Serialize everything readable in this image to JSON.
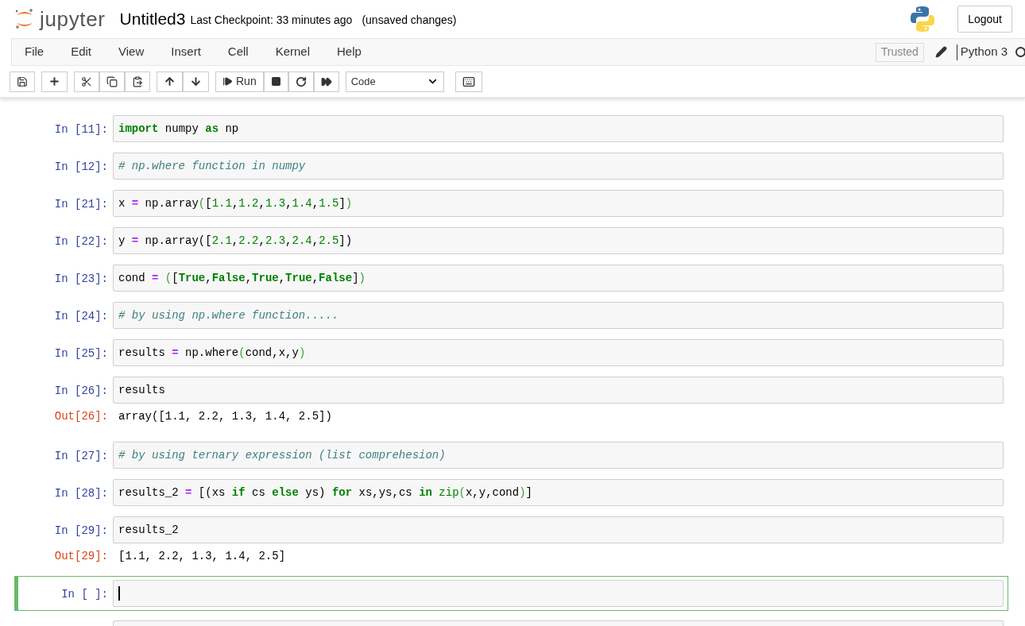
{
  "header": {
    "logo_text": "jupyter",
    "notebook_name": "Untitled3",
    "checkpoint": "Last Checkpoint: 33 minutes ago",
    "save_status": "(unsaved changes)",
    "logout": "Logout"
  },
  "menu": [
    "File",
    "Edit",
    "View",
    "Insert",
    "Cell",
    "Kernel",
    "Help"
  ],
  "status": {
    "trusted": "Trusted",
    "kernel_name": "Python 3",
    "kernel_busy": false
  },
  "toolbar": {
    "run_label": "Run",
    "cell_type": "Code"
  },
  "cells": [
    {
      "prompt": "In [11]:",
      "selected": false,
      "editing": false,
      "code": [
        {
          "kind": "keyword",
          "text": "import"
        },
        {
          "kind": "plain",
          "text": " numpy "
        },
        {
          "kind": "keyword",
          "text": "as"
        },
        {
          "kind": "plain",
          "text": " np"
        }
      ]
    },
    {
      "prompt": "In [12]:",
      "selected": false,
      "editing": false,
      "code": [
        {
          "kind": "comment",
          "text": "# np.where function in numpy"
        }
      ]
    },
    {
      "prompt": "In [21]:",
      "selected": false,
      "editing": false,
      "code": [
        {
          "kind": "plain",
          "text": "x "
        },
        {
          "kind": "operator",
          "text": "="
        },
        {
          "kind": "plain",
          "text": " np.array"
        },
        {
          "kind": "bracket",
          "text": "("
        },
        {
          "kind": "plain",
          "text": "["
        },
        {
          "kind": "number",
          "text": "1.1"
        },
        {
          "kind": "plain",
          "text": ","
        },
        {
          "kind": "number",
          "text": "1.2"
        },
        {
          "kind": "plain",
          "text": ","
        },
        {
          "kind": "number",
          "text": "1.3"
        },
        {
          "kind": "plain",
          "text": ","
        },
        {
          "kind": "number",
          "text": "1.4"
        },
        {
          "kind": "plain",
          "text": ","
        },
        {
          "kind": "number",
          "text": "1.5"
        },
        {
          "kind": "plain",
          "text": "]"
        },
        {
          "kind": "bracket",
          "text": ")"
        }
      ]
    },
    {
      "prompt": "In [22]:",
      "selected": false,
      "editing": false,
      "code": [
        {
          "kind": "plain",
          "text": "y "
        },
        {
          "kind": "operator",
          "text": "="
        },
        {
          "kind": "plain",
          "text": " np.array(["
        },
        {
          "kind": "number",
          "text": "2.1"
        },
        {
          "kind": "plain",
          "text": ","
        },
        {
          "kind": "number",
          "text": "2.2"
        },
        {
          "kind": "plain",
          "text": ","
        },
        {
          "kind": "number",
          "text": "2.3"
        },
        {
          "kind": "plain",
          "text": ","
        },
        {
          "kind": "number",
          "text": "2.4"
        },
        {
          "kind": "plain",
          "text": ","
        },
        {
          "kind": "number",
          "text": "2.5"
        },
        {
          "kind": "plain",
          "text": "])"
        }
      ]
    },
    {
      "prompt": "In [23]:",
      "selected": false,
      "editing": false,
      "code": [
        {
          "kind": "plain",
          "text": "cond "
        },
        {
          "kind": "operator",
          "text": "="
        },
        {
          "kind": "bracket",
          "text": " ("
        },
        {
          "kind": "plain",
          "text": "["
        },
        {
          "kind": "keyword",
          "text": "True"
        },
        {
          "kind": "plain",
          "text": ","
        },
        {
          "kind": "keyword",
          "text": "False"
        },
        {
          "kind": "plain",
          "text": ","
        },
        {
          "kind": "keyword",
          "text": "True"
        },
        {
          "kind": "plain",
          "text": ","
        },
        {
          "kind": "keyword",
          "text": "True"
        },
        {
          "kind": "plain",
          "text": ","
        },
        {
          "kind": "keyword",
          "text": "False"
        },
        {
          "kind": "plain",
          "text": "]"
        },
        {
          "kind": "bracket",
          "text": ")"
        }
      ]
    },
    {
      "prompt": "In [24]:",
      "selected": false,
      "editing": false,
      "code": [
        {
          "kind": "comment",
          "text": "# by using np.where function....."
        }
      ]
    },
    {
      "prompt": "In [25]:",
      "selected": false,
      "editing": false,
      "code": [
        {
          "kind": "plain",
          "text": "results "
        },
        {
          "kind": "operator",
          "text": "="
        },
        {
          "kind": "plain",
          "text": " np.where"
        },
        {
          "kind": "bracket",
          "text": "("
        },
        {
          "kind": "plain",
          "text": "cond,x,y"
        },
        {
          "kind": "bracket",
          "text": ")"
        }
      ]
    },
    {
      "prompt": "In [26]:",
      "selected": false,
      "editing": false,
      "code": [
        {
          "kind": "plain",
          "text": "results"
        }
      ],
      "out_prompt": "Out[26]:",
      "output": "array([1.1, 2.2, 1.3, 1.4, 2.5])"
    },
    {
      "prompt": "In [27]:",
      "selected": false,
      "editing": false,
      "code": [
        {
          "kind": "comment",
          "text": "# by using ternary expression (list comprehesion)"
        }
      ]
    },
    {
      "prompt": "In [28]:",
      "selected": false,
      "editing": false,
      "code": [
        {
          "kind": "plain",
          "text": "results_2 "
        },
        {
          "kind": "operator",
          "text": "="
        },
        {
          "kind": "plain",
          "text": " [(xs "
        },
        {
          "kind": "keyword",
          "text": "if"
        },
        {
          "kind": "plain",
          "text": " cs "
        },
        {
          "kind": "keyword",
          "text": "else"
        },
        {
          "kind": "plain",
          "text": " ys) "
        },
        {
          "kind": "keyword",
          "text": "for"
        },
        {
          "kind": "plain",
          "text": " xs,ys,cs "
        },
        {
          "kind": "keyword",
          "text": "in"
        },
        {
          "kind": "builtin",
          "text": " zip"
        },
        {
          "kind": "bracket",
          "text": "("
        },
        {
          "kind": "plain",
          "text": "x,y,cond"
        },
        {
          "kind": "bracket",
          "text": ")"
        },
        {
          "kind": "plain",
          "text": "]"
        }
      ]
    },
    {
      "prompt": "In [29]:",
      "selected": false,
      "editing": false,
      "code": [
        {
          "kind": "plain",
          "text": "results_2"
        }
      ],
      "out_prompt": "Out[29]:",
      "output": "[1.1, 2.2, 1.3, 1.4, 2.5]"
    },
    {
      "prompt": "In [ ]:",
      "selected": true,
      "editing": true
    },
    {
      "selected": false
    }
  ]
}
